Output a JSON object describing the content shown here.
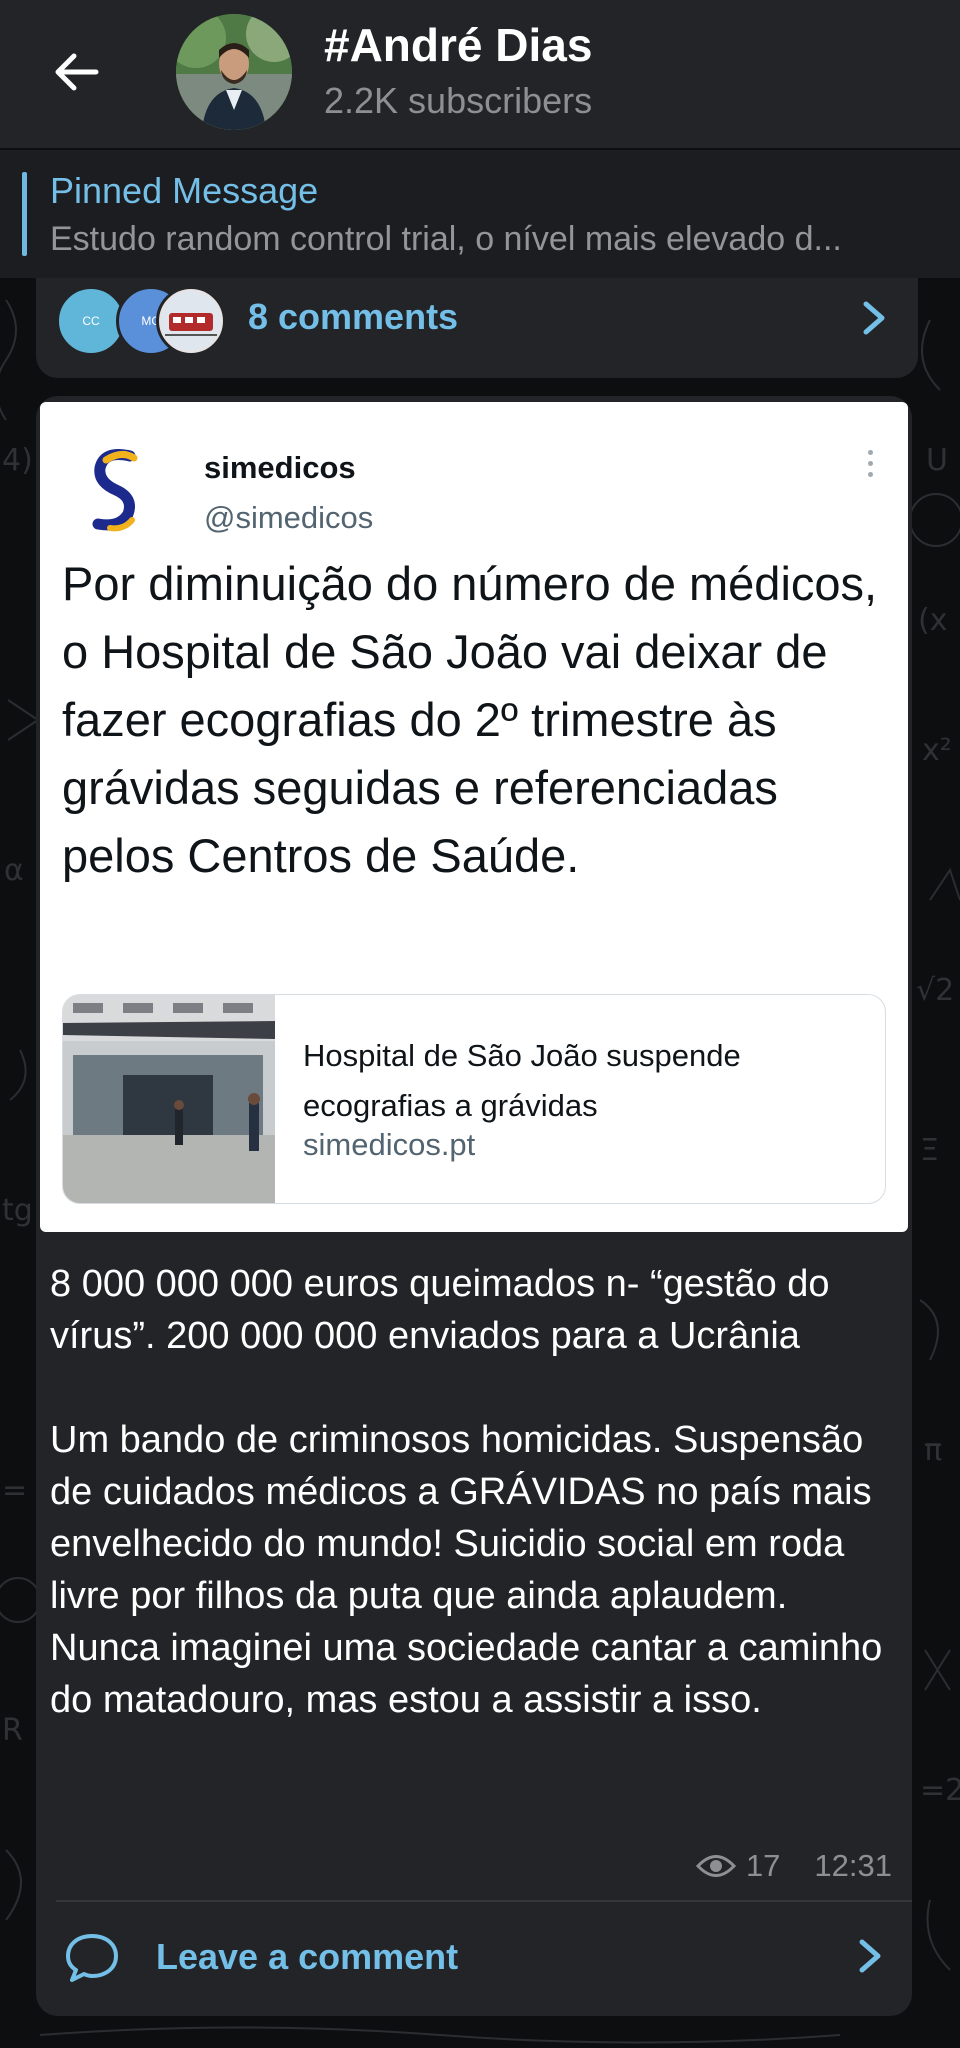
{
  "header": {
    "title": "#André Dias",
    "subscribers": "2.2K subscribers",
    "back_icon": "arrow-left-icon"
  },
  "pinned": {
    "title": "Pinned Message",
    "text": "Estudo random control trial, o nível mais elevado d..."
  },
  "previous_post": {
    "comments_label": "8 comments",
    "avatars": [
      {
        "initials": "CC",
        "color": "#5fb6d8"
      },
      {
        "initials": "MG",
        "color": "#5a8fd9"
      },
      {
        "initials": "",
        "color": "#b22a2a"
      }
    ]
  },
  "tweet": {
    "name": "simedicos",
    "handle": "@simedicos",
    "text": "Por diminuição do número de médicos, o Hospital de São João vai deixar de fazer ecografias do 2º trimestre às grávidas seguidas e referenciadas pelos Centros de Saúde.",
    "link_title": "Hospital de São João suspende ecografias a grávidas",
    "link_domain": "simedicos.pt"
  },
  "post": {
    "text": "8 000 000 000 euros queimados n- “gestão do vírus”. 200 000 000 enviados para a Ucrânia\n\nUm bando de criminosos homicidas. Suspensão de cuidados médicos a GRÁVIDAS no país mais envelhecido do mundo! Suicidio social em roda livre por filhos da puta que ainda aplaudem. Nunca imaginei uma sociedade cantar a caminho do matadouro, mas estou a assistir a isso.",
    "views": "17",
    "time": "12:31",
    "leave_comment_label": "Leave a comment"
  },
  "colors": {
    "accent": "#74bfe8",
    "header_bg": "#232427",
    "bubble_bg": "#232427",
    "page_bg": "#0d0e10"
  }
}
